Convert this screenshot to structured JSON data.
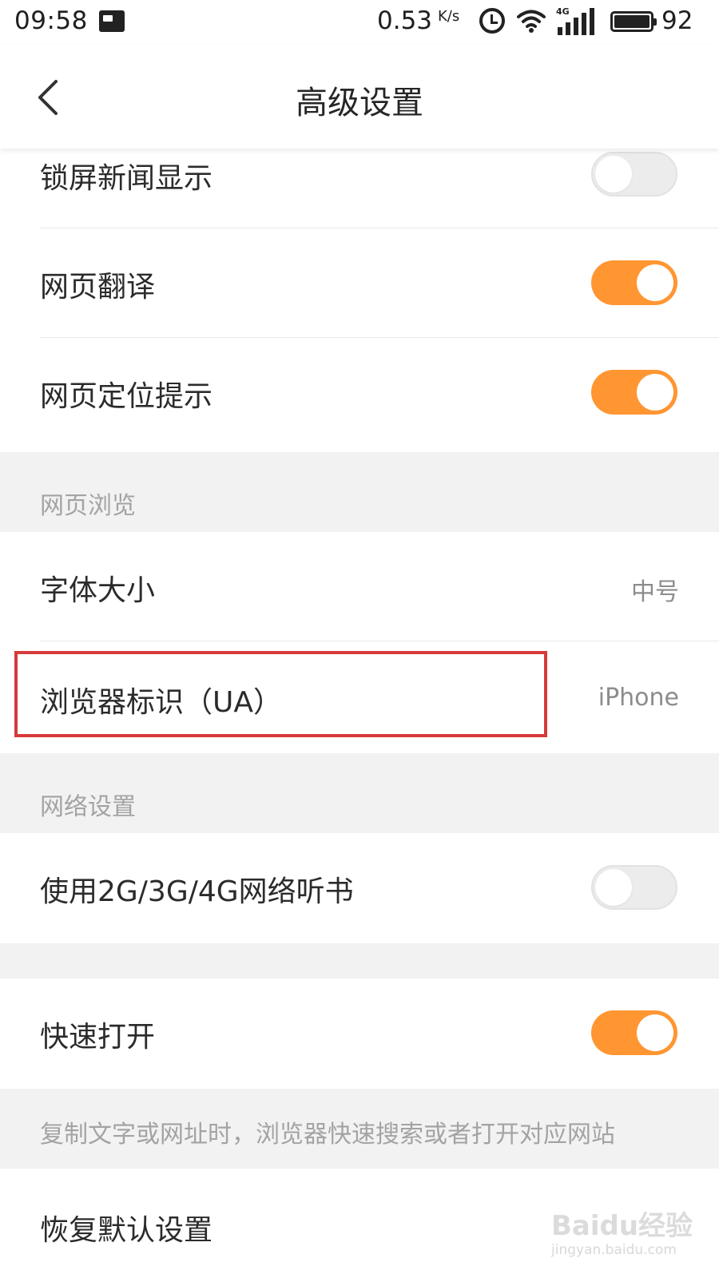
{
  "status_bar": {
    "time": "09:58",
    "network_speed": "0.53",
    "network_speed_unit": "K/s",
    "network_type": "4G",
    "battery_percent": "92",
    "icons": [
      "picture-notification-icon",
      "alarm-icon",
      "wifi-icon",
      "signal-icon",
      "battery-icon"
    ]
  },
  "header": {
    "title": "高级设置",
    "back_icon": "chevron-left-icon"
  },
  "settings": {
    "lock_screen_news": {
      "label": "锁屏新闻显示",
      "enabled": false
    },
    "page_translate": {
      "label": "网页翻译",
      "enabled": true
    },
    "location_prompt": {
      "label": "网页定位提示",
      "enabled": true
    },
    "browsing_section": {
      "title": "网页浏览"
    },
    "font_size": {
      "label": "字体大小",
      "value": "中号"
    },
    "user_agent": {
      "label": "浏览器标识（UA）",
      "value": "iPhone"
    },
    "network_section": {
      "title": "网络设置"
    },
    "mobile_listen": {
      "label": "使用2G/3G/4G网络听书",
      "enabled": false
    },
    "quick_open": {
      "label": "快速打开",
      "enabled": true,
      "description": "复制文字或网址时，浏览器快速搜索或者打开对应网站"
    },
    "restore_defaults": {
      "label": "恢复默认设置"
    }
  },
  "watermark": {
    "brand": "Baidu经验",
    "url": "jingyan.baidu.com"
  },
  "colors": {
    "accent_orange": "#ff9632",
    "highlight_red": "#d63a3a",
    "section_gray": "#f2f2f2"
  }
}
